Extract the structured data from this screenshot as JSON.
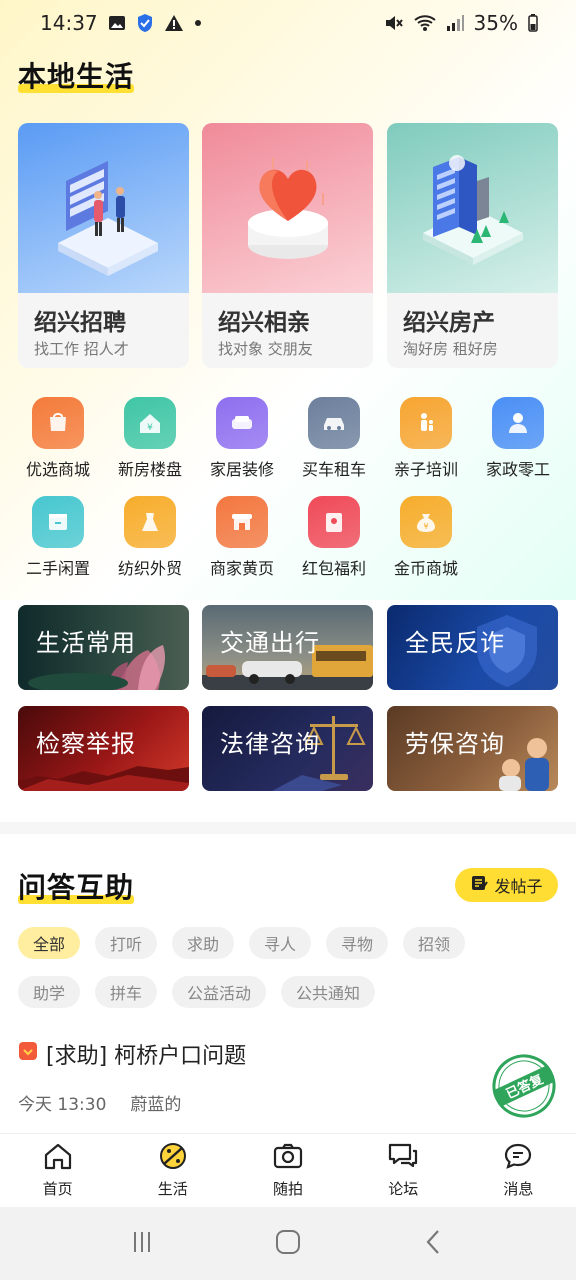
{
  "status_bar": {
    "time": "14:37",
    "battery": "35%",
    "icons": [
      "image-icon",
      "shield-icon",
      "warning-icon",
      "dot-icon",
      "mute-icon",
      "wifi-icon",
      "signal-icon",
      "battery-icon"
    ]
  },
  "local_life": {
    "title": "本地生活",
    "cards": [
      {
        "name": "绍兴招聘",
        "sub": "找工作  招人才",
        "color": "#6aa8f5"
      },
      {
        "name": "绍兴相亲",
        "sub": "找对象  交朋友",
        "color": "#f59aa5"
      },
      {
        "name": "绍兴房产",
        "sub": "淘好房  租好房",
        "color": "#8fd4c6"
      }
    ],
    "grid": [
      {
        "label": "优选商城",
        "icon": "shopping-bag-icon",
        "color": "#f47b3b"
      },
      {
        "label": "新房楼盘",
        "icon": "house-icon",
        "color": "#3fc6a6"
      },
      {
        "label": "家居装修",
        "icon": "sofa-icon",
        "color": "#8e6ff0"
      },
      {
        "label": "买车租车",
        "icon": "car-icon",
        "color": "#6c7f9c"
      },
      {
        "label": "亲子培训",
        "icon": "parent-child-icon",
        "color": "#f7a531"
      },
      {
        "label": "家政零工",
        "icon": "worker-icon",
        "color": "#4b8ff5"
      },
      {
        "label": "二手闲置",
        "icon": "box-icon",
        "color": "#47c7d0"
      },
      {
        "label": "纺织外贸",
        "icon": "dress-icon",
        "color": "#f7ad2c"
      },
      {
        "label": "商家黄页",
        "icon": "storefront-icon",
        "color": "#f3773f"
      },
      {
        "label": "红包福利",
        "icon": "red-envelope-icon",
        "color": "#f04a58"
      },
      {
        "label": "金币商城",
        "icon": "money-bag-icon",
        "color": "#f7ad2c"
      }
    ],
    "services": [
      {
        "label": "生活常用"
      },
      {
        "label": "交通出行"
      },
      {
        "label": "全民反诈"
      },
      {
        "label": "检察举报"
      },
      {
        "label": "法律咨询"
      },
      {
        "label": "劳保咨询"
      }
    ]
  },
  "qa": {
    "title": "问答互助",
    "post_button": "发帖子",
    "chips": [
      "全部",
      "打听",
      "求助",
      "寻人",
      "寻物",
      "招领",
      "助学",
      "拼车",
      "公益活动",
      "公共通知"
    ],
    "active_chip": "全部",
    "post": {
      "title": "[求助] 柯桥户口问题",
      "time": "今天 13:30",
      "author": "蔚蓝的",
      "stamp": "已答复"
    }
  },
  "tabbar": [
    {
      "label": "首页",
      "icon": "home-icon"
    },
    {
      "label": "生活",
      "icon": "life-icon"
    },
    {
      "label": "随拍",
      "icon": "camera-icon"
    },
    {
      "label": "论坛",
      "icon": "chat-bubbles-icon"
    },
    {
      "label": "消息",
      "icon": "message-icon"
    }
  ]
}
